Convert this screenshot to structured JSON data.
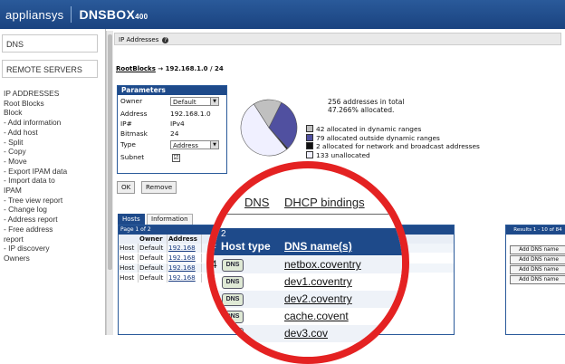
{
  "app": {
    "brand": "appliansys",
    "product": "DNSBOX",
    "version": "400"
  },
  "sidebar": {
    "dns": "DNS",
    "remote_servers": "REMOTE SERVERS",
    "tree": [
      "IP ADDRESSES",
      "Root Blocks",
      "Block",
      "- Add information",
      "- Add host",
      "- Split",
      "- Copy",
      "- Move",
      "- Export IPAM data",
      "- Import data to",
      "IPAM",
      "- Tree view report",
      "- Change log",
      "- Address report",
      "- Free address",
      "report",
      "- IP discovery",
      "Owners"
    ]
  },
  "header": {
    "title": "IP Addresses",
    "help": "?"
  },
  "root": {
    "link": "RootBlocks",
    "path": " → 192.168.1.0 / 24"
  },
  "params": {
    "title": "Parameters",
    "owner_label": "Owner",
    "owner_value": "Default",
    "address_label": "Address",
    "address_value": "192.168.1.0",
    "ipnum_label": "IP#",
    "ipnum_value": "IPv4",
    "bitmask_label": "Bitmask",
    "bitmask_value": "24",
    "type_label": "Type",
    "type_value": "Address",
    "subnet_label": "Subnet",
    "subnet_check": "☑"
  },
  "buttons": {
    "ok": "OK",
    "remove": "Remove"
  },
  "summary": {
    "total": "256 addresses in total",
    "allocated": "47.266% allocated."
  },
  "legend": [
    {
      "text": "42 allocated in dynamic ranges",
      "color": "#c0c0c0"
    },
    {
      "text": "79 allocated outside dynamic ranges",
      "color": "#5050a0"
    },
    {
      "text": "2 allocated for network and broadcast addresses",
      "color": "#111111"
    },
    {
      "text": "133 unallocated",
      "color": "#f0f0ff"
    }
  ],
  "tabs": {
    "hosts": "Hosts",
    "information": "Information",
    "leases": "ases"
  },
  "table": {
    "page": "Page 1 of 2",
    "results": "Results 1 - 10 of 84",
    "cols": [
      "Owner",
      "Address"
    ],
    "rows": [
      {
        "kind": "Host",
        "owner": "Default",
        "address": "192.168"
      },
      {
        "kind": "Host",
        "owner": "Default",
        "address": "192.168"
      },
      {
        "kind": "Host",
        "owner": "Default",
        "address": "192.168"
      },
      {
        "kind": "Host",
        "owner": "Default",
        "address": "192.168"
      }
    ],
    "add_dns": "Add DNS name"
  },
  "lens": {
    "tab1": "ge",
    "tab2": "DNS",
    "tab3": "DHCP bindings",
    "page": "2",
    "col_num": "#",
    "col_host": "Host type",
    "col_dns": "DNS name(s)",
    "row_num": "4",
    "badge": "DNS",
    "names": [
      "netbox.coventry",
      "dev1.coventry",
      "dev2.coventry",
      "cache.covent",
      "dev3.cov"
    ]
  }
}
